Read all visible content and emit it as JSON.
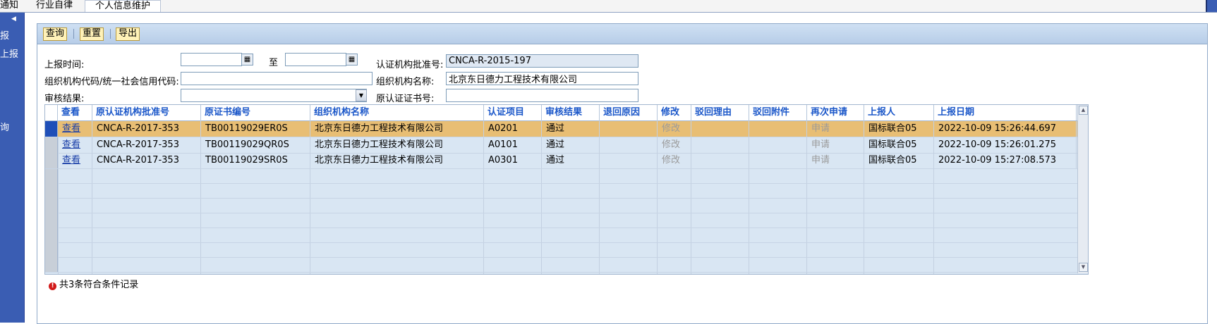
{
  "nav": {
    "items": [
      "报",
      "上报",
      "询"
    ],
    "collapse_icon": "triangle-left-icon"
  },
  "tabs": [
    "通知",
    "行业自律",
    "个人信息维护"
  ],
  "toolbar": {
    "query_label": "查询",
    "reset_label": "重置",
    "export_label": "导出"
  },
  "form": {
    "report_time_label": "上报时间:",
    "to_label": "至",
    "report_time_from": "",
    "report_time_to": "",
    "approval_no_label": "认证机构批准号:",
    "approval_no_value": "CNCA-R-2015-197",
    "org_code_label": "组织机构代码/统一社会信用代码:",
    "org_code_value": "",
    "org_name_label": "组织机构名称:",
    "org_name_value": "北京东日德力工程技术有限公司",
    "review_result_label": "审核结果:",
    "review_result_value": "",
    "orig_cert_label": "原认证证书号:",
    "orig_cert_value": ""
  },
  "grid": {
    "columns": [
      "查看",
      "原认证机构批准号",
      "原证书编号",
      "组织机构名称",
      "认证项目",
      "审核结果",
      "退回原因",
      "修改",
      "驳回理由",
      "驳回附件",
      "再次申请",
      "上报人",
      "上报日期"
    ],
    "rows": [
      {
        "view": "查看",
        "orig_approval": "CNCA-R-2017-353",
        "cert_no": "TB00119029ER0S",
        "org": "北京东日德力工程技术有限公司",
        "project": "A0201",
        "result": "通过",
        "return_reason": "",
        "modify": "修改",
        "reject_reason": "",
        "reject_attach": "",
        "reapply": "申请",
        "reporter": "国标联合05",
        "date": "2022-10-09 15:26:44.697"
      },
      {
        "view": "查看",
        "orig_approval": "CNCA-R-2017-353",
        "cert_no": "TB00119029QR0S",
        "org": "北京东日德力工程技术有限公司",
        "project": "A0101",
        "result": "通过",
        "return_reason": "",
        "modify": "修改",
        "reject_reason": "",
        "reject_attach": "",
        "reapply": "申请",
        "reporter": "国标联合05",
        "date": "2022-10-09 15:26:01.275"
      },
      {
        "view": "查看",
        "orig_approval": "CNCA-R-2017-353",
        "cert_no": "TB00119029SR0S",
        "org": "北京东日德力工程技术有限公司",
        "project": "A0301",
        "result": "通过",
        "return_reason": "",
        "modify": "修改",
        "reject_reason": "",
        "reject_attach": "",
        "reapply": "申请",
        "reporter": "国标联合05",
        "date": "2022-10-09 15:27:08.573"
      }
    ]
  },
  "status": {
    "text": "共3条符合条件记录",
    "icon": "warning-icon"
  }
}
